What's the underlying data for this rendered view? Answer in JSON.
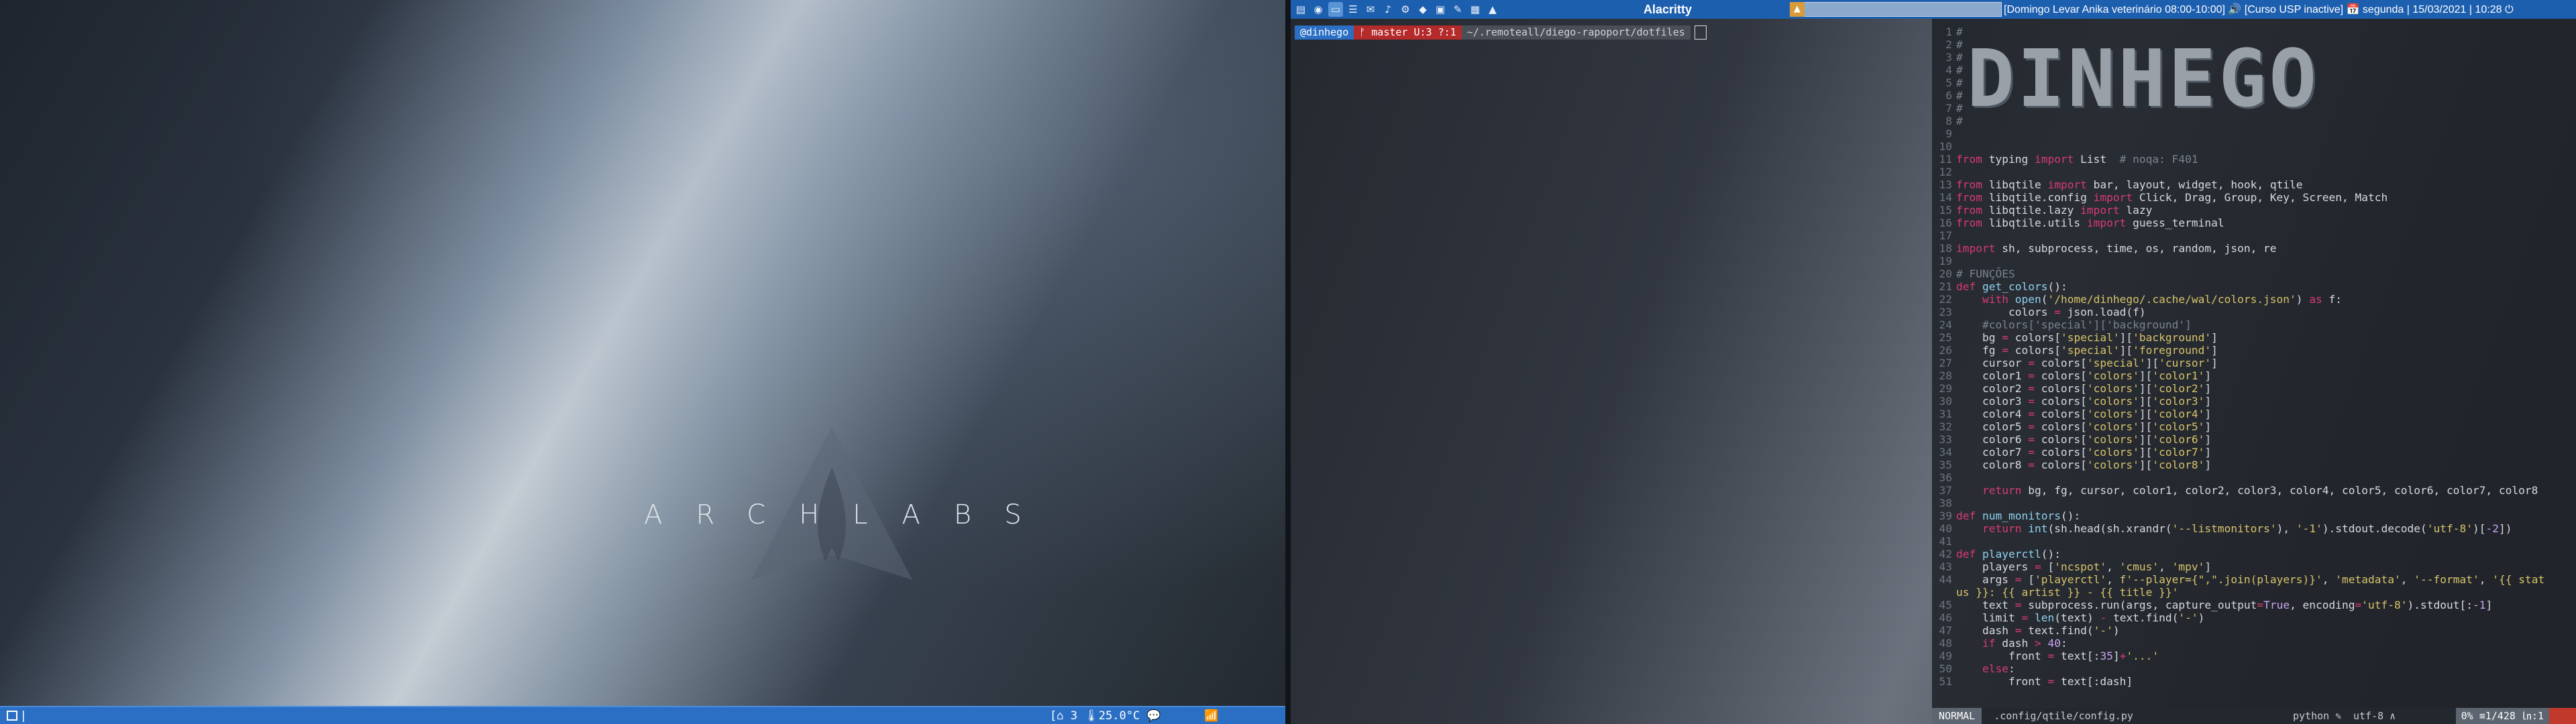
{
  "left_screen": {
    "logo_text": "ARCHLABS",
    "bar": {
      "right_widgets": "[⌂ 3 🌡25.0°C 💬",
      "wifi": "📶"
    }
  },
  "right_screen": {
    "topbar": {
      "window_title": "Alacritty",
      "event_text": "[Domingo Levar Anika veterinário 08:00-10:00] 🔊 [Curso USP inactive] 📅 segunda | 15/03/2021 | 10:28 ⏻"
    },
    "terminal": {
      "user": "@dinhego",
      "git": "ᚠ master U:3 ?:1",
      "path": "~/.remoteall/diego-rapoport/dotfiles"
    },
    "editor": {
      "banner": "DINHEGO",
      "mode": "NORMAL",
      "file": ".config/qtile/config.py",
      "filetype": "python ✎",
      "encoding": "utf-8 ∧",
      "position": "0% ≡1/428 ㏑:1"
    }
  }
}
